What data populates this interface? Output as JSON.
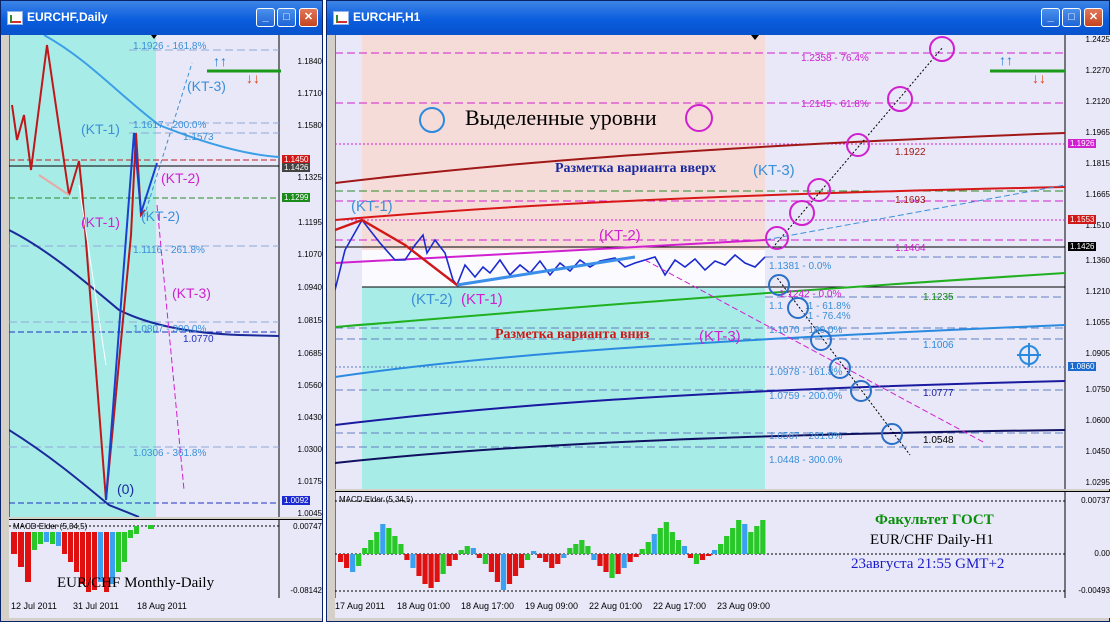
{
  "left_window": {
    "title": "EURCHF,Daily",
    "price_labels": [
      "1.1840",
      "1.1710",
      "1.1580",
      "1.1450",
      "1.1325",
      "1.1195",
      "1.1070",
      "1.0940",
      "1.0815",
      "1.0685",
      "1.0560",
      "1.0430",
      "1.0300",
      "1.0175",
      "1.0045"
    ],
    "badges": {
      "red": "1.1450",
      "green": "1.1299",
      "blue": "1.0092",
      "gray": "1.1426"
    },
    "fib_labels": [
      "1.1926 - 161.8%",
      "1.1617 - 200.0%",
      "1.1573",
      "1.1116 - 261.8%",
      "1.0807 - 300.0%",
      "1.0770",
      "1.0306 - 361.8%"
    ],
    "wave_labels": {
      "kt1a": "(KT-1)",
      "kt1b": "(KT-1)",
      "kt2a": "(KT-2)",
      "kt2b": "(KT-2)",
      "kt3a": "(KT-3)",
      "kt3b": "(KT-3)",
      "zero": "(0)"
    },
    "macd_title": "MACD Elder (5,34,5)",
    "macd_levels": [
      "0.00747",
      "-0.08142"
    ],
    "caption": "EUR/CHF Monthly-Daily",
    "dates": [
      "12 Jul 2011",
      "31 Jul 2011",
      "18 Aug 2011"
    ]
  },
  "right_window": {
    "title": "EURCHF,H1",
    "price_labels": [
      "1.2425",
      "1.2270",
      "1.2120",
      "1.1965",
      "1.1815",
      "1.1665",
      "1.1510",
      "1.1360",
      "1.1210",
      "1.1055",
      "1.0905",
      "1.0750",
      "1.0600",
      "1.0450",
      "1.0295"
    ],
    "badges": {
      "magenta": "1.1926",
      "red": "1.1553",
      "black": "1.1426",
      "blue": "1.0860"
    },
    "legend_text": "Выделенные уровни",
    "up_note": "Разметка варианта вверх",
    "down_note": "Разметка варианта вниз",
    "fib_up": [
      "1.2358 - 76.4%",
      "1.2145 - 61.8%",
      "1.1922",
      "1.1693",
      "1.1464"
    ],
    "fib_down": [
      "1.1381 - 0.0%",
      "1.1242 - 0.0%",
      "1.1235",
      "1.1",
      ".1 - 61.8%",
      ".1 - 76.4%",
      "1.1070 - 100.0%",
      "1.1006",
      "1.0978 - 161.8%",
      "1.0759 - 200.0%",
      "1.0777",
      "1.0567 - 261.8%",
      "1.0548",
      "1.0448 - 300.0%"
    ],
    "wave_labels": {
      "kt1a": "(KT-1)",
      "kt1b": "(KT-1)",
      "kt2a": "(KT-2)",
      "kt2b": "(KT-2)",
      "kt3a": "(KT-3)",
      "kt3b": "(KT-3)"
    },
    "macd_title": "MACD Elder (5,34,5)",
    "macd_levels": [
      "0.00737",
      "0.00",
      "-0.00493"
    ],
    "caption": {
      "line1": "Факультет ГОСТ",
      "line2": "EUR/CHF Daily-H1",
      "line3": "23августа 21:55 GMT+2"
    },
    "dates": [
      "17 Aug 2011",
      "18 Aug 01:00",
      "18 Aug 17:00",
      "19 Aug 09:00",
      "22 Aug 01:00",
      "22 Aug 17:00",
      "23 Aug 09:00"
    ]
  },
  "colors": {
    "cyan_zone": "#a8ece8",
    "pink_zone": "#f6dcd8",
    "chart_bg": "#e8e8f8",
    "magenta": "#d020d0",
    "blue_label": "#3b8fd8",
    "green_caption": "#0a8f0a",
    "blue_caption": "#1a1acc"
  }
}
